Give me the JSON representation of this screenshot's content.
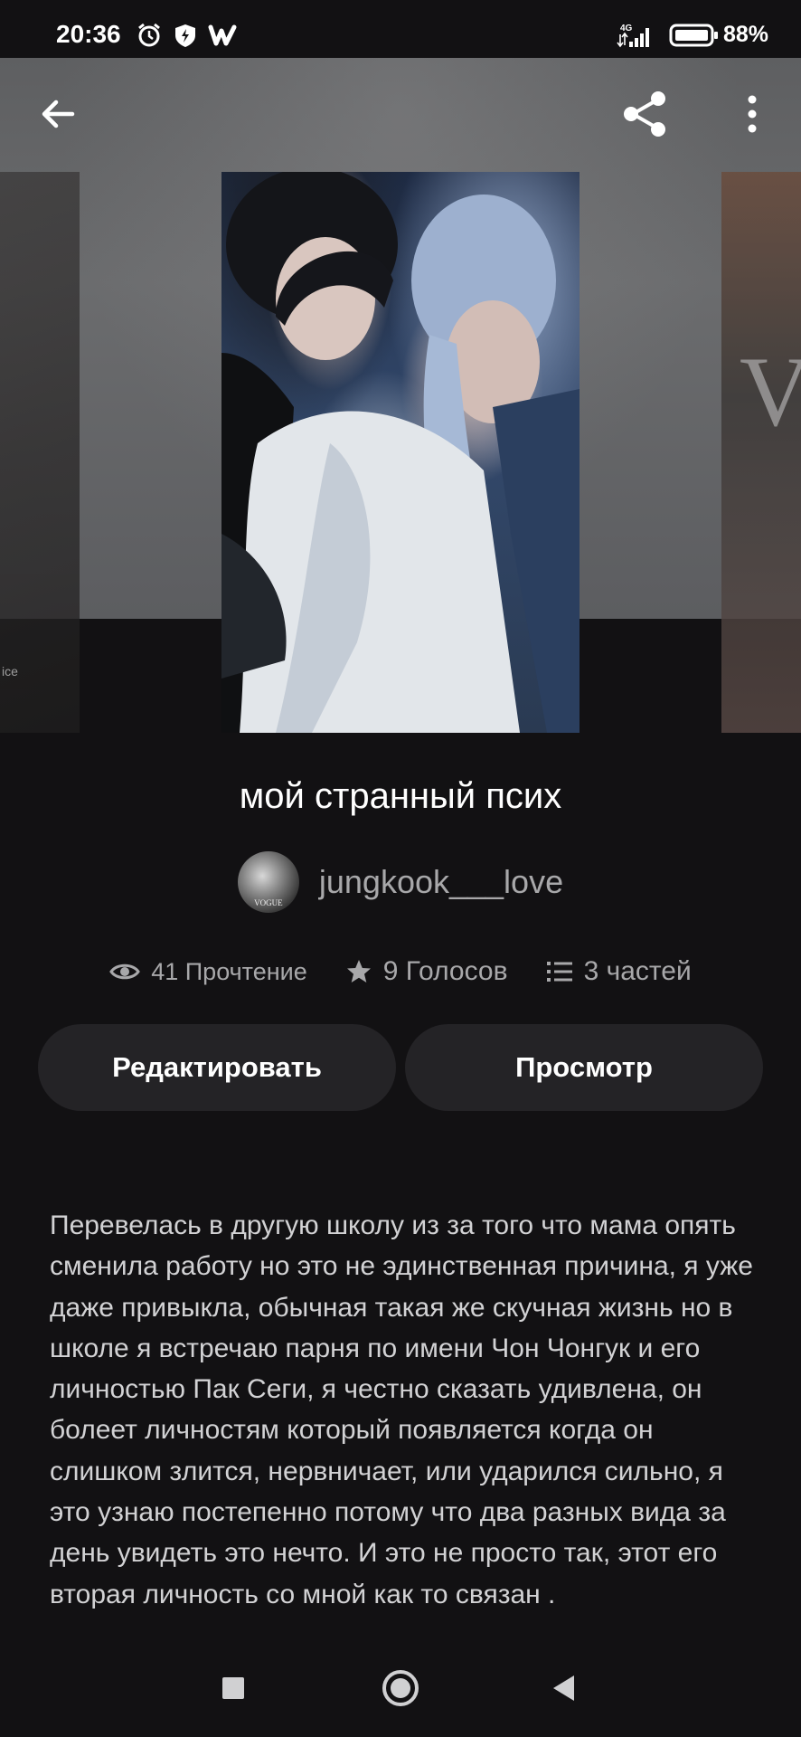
{
  "status_bar": {
    "time": "20:36",
    "network": "4G",
    "battery": "88%",
    "icons": [
      "alarm-icon",
      "shield-icon",
      "w-app-icon",
      "signal-icon",
      "battery-icon"
    ]
  },
  "topbar": {
    "icons": [
      "back-arrow-icon",
      "share-icon",
      "more-vert-icon"
    ]
  },
  "covers": {
    "left_partial_text": "ice",
    "right_partial_text": "V"
  },
  "story": {
    "title": "мой странный псих",
    "author": "jungkook___love",
    "avatar_text": "VOGUE"
  },
  "stats": {
    "reads": "41 Прочтение",
    "votes": "9 Голосов",
    "parts": "3 частей"
  },
  "actions": {
    "edit_label": "Редактировать",
    "view_label": "Просмотр"
  },
  "description": "Перевелась в другую школу из за того что мама опять сменила работу но это не эдинственная причина, я уже даже привыкла, обычная такая же скучная жизнь но в школе я встречаю парня по имени Чон Чонгук и его личностью Пак Сеги, я честно сказать удивлена, он болеет личностям который появляется когда он слишком злится, нервничает, или ударился сильно, я это узнаю постепенно потому что два разных вида за день увидеть это нечто. И это не просто так, этот его вторая личность со мной как то связан .",
  "colors": {
    "background": "#121113",
    "button_bg": "#242326",
    "secondary_text": "#a8a8aa"
  }
}
